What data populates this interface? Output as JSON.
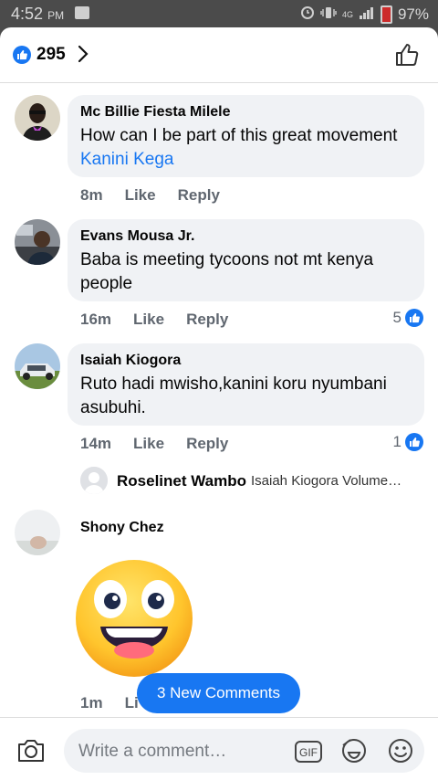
{
  "status_bar": {
    "time": "4:52",
    "ampm": "PM",
    "network": "4G",
    "battery": "97%"
  },
  "header": {
    "like_count": "295"
  },
  "comments": [
    {
      "author": "Mc Billie Fiesta Milele",
      "text": "How can I be part of this great movement ",
      "tag": "Kanini Kega",
      "time": "8m",
      "like": "Like",
      "reply": "Reply",
      "reactions": ""
    },
    {
      "author": "Evans Mousa Jr.",
      "text": "Baba is meeting tycoons not mt kenya people",
      "time": "16m",
      "like": "Like",
      "reply": "Reply",
      "reactions": "5"
    },
    {
      "author": "Isaiah Kiogora",
      "text": "Ruto hadi mwisho,kanini koru nyumbani asubuhi.",
      "time": "14m",
      "like": "Like",
      "reply": "Reply",
      "reactions": "1"
    },
    {
      "author": "Shony Chez",
      "time": "1m",
      "like": "Li"
    }
  ],
  "reply_preview": {
    "author": "Roselinet Wambo",
    "preview": "Isaiah Kiogora Volume…"
  },
  "new_comments_label": "3 New Comments",
  "composer": {
    "placeholder": "Write a comment…",
    "gif_label": "GIF"
  },
  "colors": {
    "accent": "#1877f2",
    "bubble": "#f0f2f5",
    "status_bar": "#4b4b4b"
  }
}
